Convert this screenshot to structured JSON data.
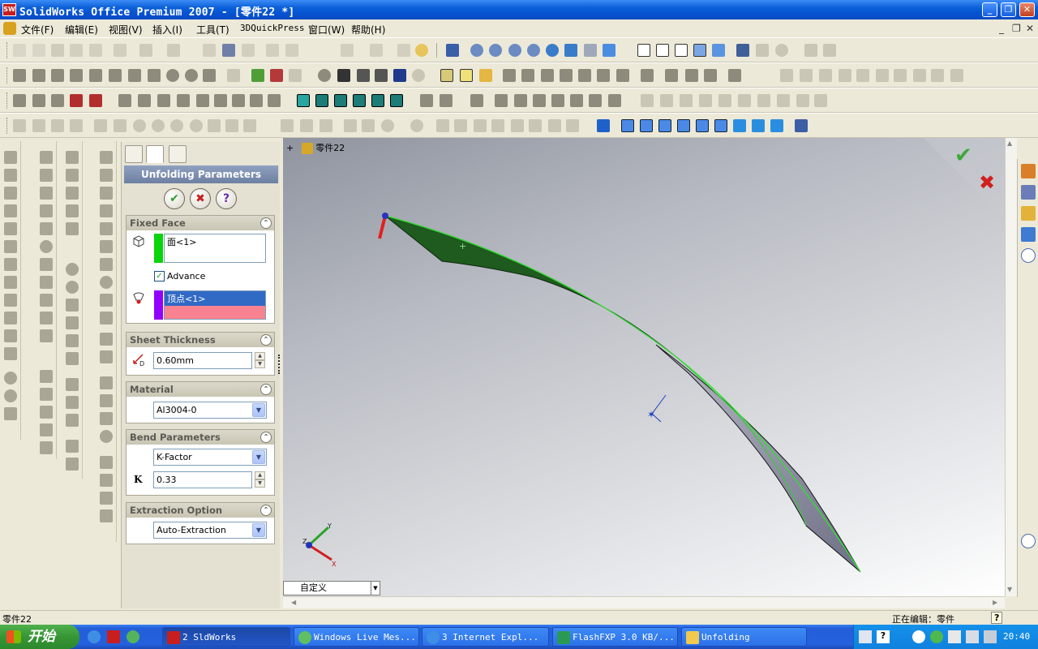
{
  "window": {
    "title": "SolidWorks Office Premium 2007 - [零件22 *]",
    "app_icon_text": "SW",
    "minimize": "_",
    "restore": "❐",
    "close": "✕"
  },
  "menu": {
    "items": [
      "文件(F)",
      "编辑(E)",
      "视图(V)",
      "插入(I)",
      "工具(T)",
      "3DQuickPress",
      "窗口(W)",
      "帮助(H)"
    ],
    "mdi_min": "_",
    "mdi_restore": "❐",
    "mdi_close": "✕"
  },
  "feature_tree": {
    "expander": "+",
    "root": "零件22"
  },
  "property_manager": {
    "title": "Unfolding Parameters",
    "ok": "✔",
    "cancel": "✖",
    "help": "?",
    "collapse_symbol": "⌃",
    "fixed_face": {
      "heading": "Fixed Face",
      "face_value": "面<1>",
      "advance_label": "Advance",
      "advance_checked": true,
      "vertex_value": "顶点<1>"
    },
    "sheet_thickness": {
      "heading": "Sheet Thickness",
      "value": "0.60mm"
    },
    "material": {
      "heading": "Material",
      "value": "Al3004-0"
    },
    "bend_parameters": {
      "heading": "Bend Parameters",
      "method": "K-Factor",
      "k_label": "K",
      "k_value": "0.33"
    },
    "extraction": {
      "heading": "Extraction Option",
      "value": "Auto-Extraction"
    }
  },
  "viewport": {
    "view_orientation": "自定义",
    "triad": {
      "x": "X",
      "y": "Y",
      "z": "Z"
    },
    "confirm_ok": "✔",
    "confirm_cancel": "✖"
  },
  "statusbar": {
    "left": "零件22",
    "right": "正在编辑：零件",
    "help": "?"
  },
  "taskbar": {
    "start": "开始",
    "tasks": [
      {
        "label": "2 SldWorks",
        "active": true
      },
      {
        "label": "Windows Live Mes...",
        "active": false
      },
      {
        "label": "3 Internet Expl...",
        "active": false
      },
      {
        "label": "FlashFXP 3.0 KB/...",
        "active": false
      },
      {
        "label": "Unfolding",
        "active": false
      }
    ],
    "clock": "20:40"
  },
  "colors": {
    "surface_green": "#1f5a1f",
    "surface_grey": "#8a8b9c",
    "pm_header": "#7c8db0",
    "strip_green": "#0ad40a",
    "strip_purple": "#9400ff",
    "selection_blue": "#316ac5",
    "selection_pink": "#f88290"
  }
}
